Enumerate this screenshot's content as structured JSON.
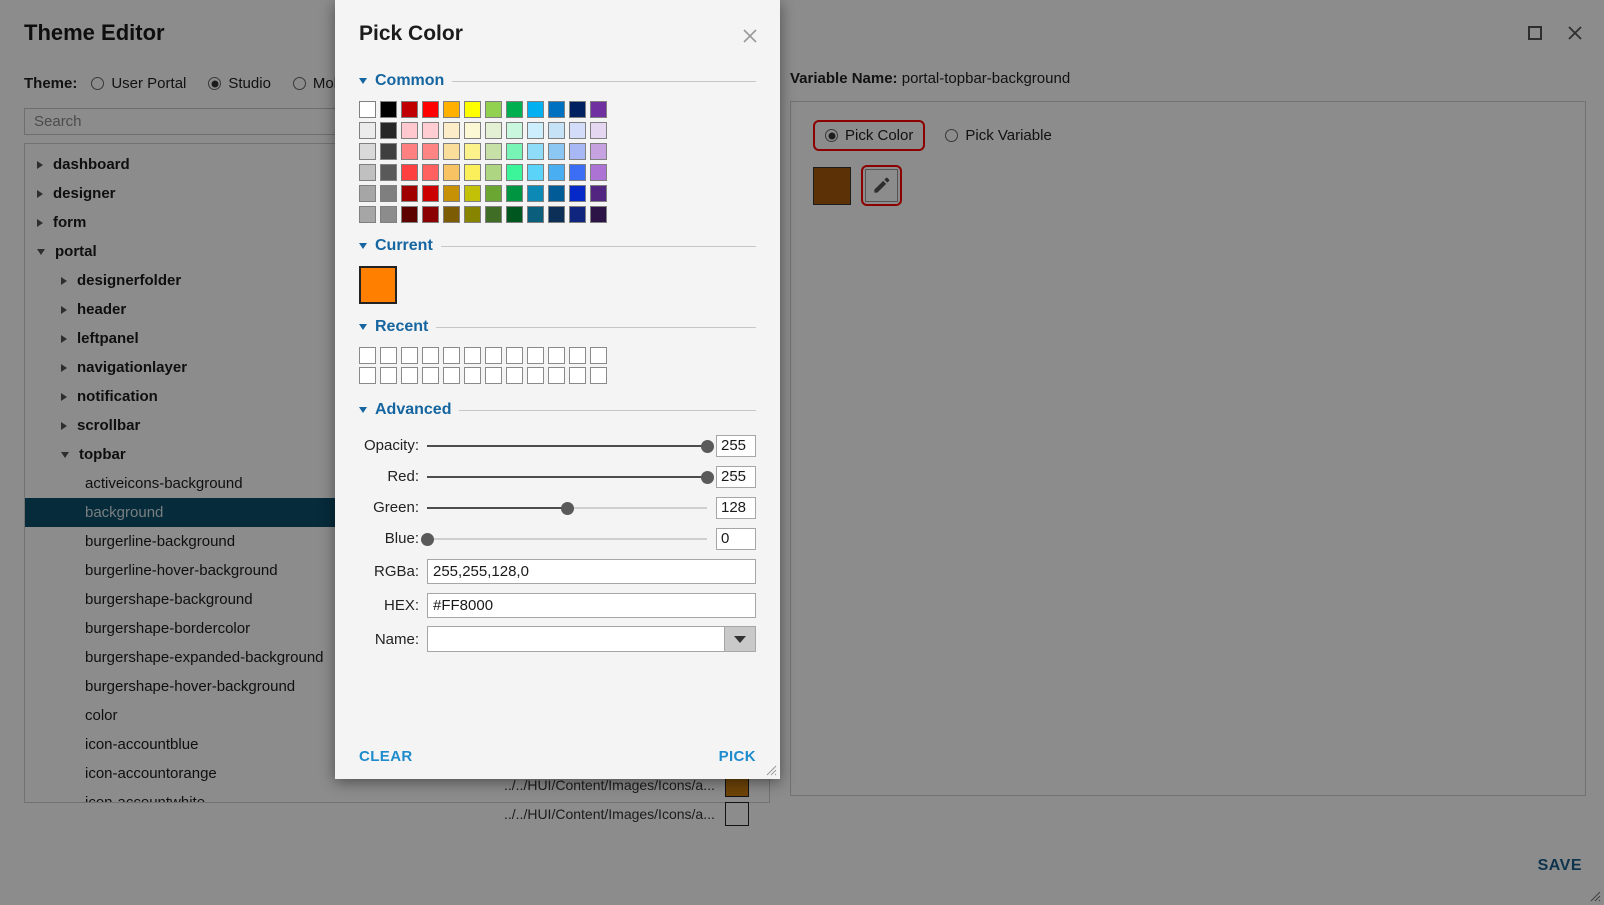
{
  "app": {
    "title": "Theme Editor",
    "window_controls": [
      {
        "name": "maximize-button",
        "glyph": "□"
      },
      {
        "name": "close-button",
        "glyph": "✕"
      }
    ],
    "theme_label": "Theme:",
    "theme_options": [
      {
        "label": "User Portal",
        "selected": false
      },
      {
        "label": "Studio",
        "selected": true
      },
      {
        "label": "Mobile",
        "selected": false
      }
    ],
    "search": {
      "placeholder": "Search",
      "value": ""
    },
    "tree": [
      {
        "label": "dashboard",
        "depth": 0,
        "state": "collapsed",
        "bold": true,
        "selected": false
      },
      {
        "label": "designer",
        "depth": 0,
        "state": "collapsed",
        "bold": true,
        "selected": false
      },
      {
        "label": "form",
        "depth": 0,
        "state": "collapsed",
        "bold": true,
        "selected": false
      },
      {
        "label": "portal",
        "depth": 0,
        "state": "expanded",
        "bold": true,
        "selected": false
      },
      {
        "label": "designerfolder",
        "depth": 1,
        "state": "collapsed",
        "bold": true,
        "selected": false
      },
      {
        "label": "header",
        "depth": 1,
        "state": "collapsed",
        "bold": true,
        "selected": false
      },
      {
        "label": "leftpanel",
        "depth": 1,
        "state": "collapsed",
        "bold": true,
        "selected": false
      },
      {
        "label": "navigationlayer",
        "depth": 1,
        "state": "collapsed",
        "bold": true,
        "selected": false
      },
      {
        "label": "notification",
        "depth": 1,
        "state": "collapsed",
        "bold": true,
        "selected": false
      },
      {
        "label": "scrollbar",
        "depth": 1,
        "state": "collapsed",
        "bold": true,
        "selected": false
      },
      {
        "label": "topbar",
        "depth": 1,
        "state": "expanded",
        "bold": true,
        "selected": false
      },
      {
        "label": "activeicons-background",
        "depth": 2,
        "state": "leaf",
        "bold": false,
        "selected": false
      },
      {
        "label": "background",
        "depth": 2,
        "state": "leaf",
        "bold": false,
        "selected": true
      },
      {
        "label": "burgerline-background",
        "depth": 2,
        "state": "leaf",
        "bold": false,
        "selected": false
      },
      {
        "label": "burgerline-hover-background",
        "depth": 2,
        "state": "leaf",
        "bold": false,
        "selected": false
      },
      {
        "label": "burgershape-background",
        "depth": 2,
        "state": "leaf",
        "bold": false,
        "selected": false
      },
      {
        "label": "burgershape-bordercolor",
        "depth": 2,
        "state": "leaf",
        "bold": false,
        "selected": false
      },
      {
        "label": "burgershape-expanded-background",
        "depth": 2,
        "state": "leaf",
        "bold": false,
        "selected": false
      },
      {
        "label": "burgershape-hover-background",
        "depth": 2,
        "state": "leaf",
        "bold": false,
        "selected": false
      },
      {
        "label": "color",
        "depth": 2,
        "state": "leaf",
        "bold": false,
        "selected": false
      },
      {
        "label": "icon-accountblue",
        "depth": 2,
        "state": "leaf",
        "bold": false,
        "selected": false
      },
      {
        "label": "icon-accountorange",
        "depth": 2,
        "state": "leaf",
        "bold": false,
        "selected": false
      },
      {
        "label": "icon-accountwhite",
        "depth": 2,
        "state": "leaf",
        "bold": false,
        "selected": false
      }
    ],
    "behind_rows": [
      {
        "text": "../../HUI/Content/Images/Icons/a...",
        "swatch": "#c87d10"
      },
      {
        "text": "../../HUI/Content/Images/Icons/a...",
        "swatch": "#ffffff"
      }
    ],
    "right_panel": {
      "variable_name_label": "Variable Name:",
      "variable_name_value": "portal-topbar-background",
      "modes": [
        {
          "label": "Pick Color",
          "selected": true,
          "highlighted": true
        },
        {
          "label": "Pick Variable",
          "selected": false,
          "highlighted": false
        }
      ],
      "current_color_swatch": "#a85a0c",
      "edit_icon": "pencil-icon"
    },
    "save_label": "SAVE"
  },
  "dialog": {
    "title": "Pick Color",
    "close_glyph": "✕",
    "sections": {
      "common": {
        "title": "Common",
        "expanded": true,
        "swatches": [
          [
            "#ffffff",
            "#000000",
            "#c00000",
            "#ff0000",
            "#ffb000",
            "#ffff00",
            "#92d050",
            "#00b050",
            "#00b0f0",
            "#0070c0",
            "#002060",
            "#7030a0"
          ],
          [
            "#ebebeb",
            "#262626",
            "#ffc7ce",
            "#ffcdd2",
            "#fdecc8",
            "#fcf8d5",
            "#e3f0d4",
            "#c9f7dd",
            "#cdeefc",
            "#c6e2f7",
            "#d3ddf9",
            "#e5d6f2"
          ],
          [
            "#d9d9d9",
            "#3f3f3f",
            "#ff8080",
            "#ff8585",
            "#fadd9b",
            "#fbf28c",
            "#c7e0a8",
            "#78f4b6",
            "#8fdcf8",
            "#8cc6f3",
            "#a8b8f4",
            "#c6a3e0"
          ],
          [
            "#c0c0c0",
            "#595959",
            "#ff4040",
            "#ff6060",
            "#f7c363",
            "#fbf05c",
            "#aed581",
            "#3cf59a",
            "#5bd2f7",
            "#49aef2",
            "#3b6ef5",
            "#ac72d4"
          ],
          [
            "#a6a6a6",
            "#7f7f7f",
            "#a00000",
            "#cc0000",
            "#c79105",
            "#c3c107",
            "#6aa631",
            "#009540",
            "#0d89b5",
            "#005b96",
            "#0529c9",
            "#522680"
          ],
          [
            "#a6a6a6",
            "#8c8c8c",
            "#5c0000",
            "#8b0000",
            "#7d5c06",
            "#878400",
            "#3f6d26",
            "#00561f",
            "#0b5f7d",
            "#0b2f57",
            "#10257e",
            "#2d1447"
          ]
        ]
      },
      "current": {
        "title": "Current",
        "expanded": true,
        "color": "#ff8000"
      },
      "recent": {
        "title": "Recent",
        "expanded": true,
        "rows": 2,
        "cols": 12,
        "colors": []
      },
      "advanced": {
        "title": "Advanced",
        "expanded": true,
        "sliders": [
          {
            "label": "Opacity:",
            "value": "255",
            "max": 255,
            "pct": 100
          },
          {
            "label": "Red:",
            "value": "255",
            "max": 255,
            "pct": 100
          },
          {
            "label": "Green:",
            "value": "128",
            "max": 255,
            "pct": 50
          },
          {
            "label": "Blue:",
            "value": "0",
            "max": 255,
            "pct": 0
          }
        ],
        "rgba": {
          "label": "RGBa:",
          "value": "255,255,128,0",
          "placeholder": ""
        },
        "hex": {
          "label": "HEX:",
          "value": "#FF8000",
          "placeholder": ""
        },
        "name": {
          "label": "Name:",
          "value": "",
          "placeholder": ""
        }
      }
    },
    "footer": {
      "clear_label": "CLEAR",
      "pick_label": "PICK"
    }
  },
  "colors": {
    "accent_blue": "#1565a0",
    "link_blue": "#1e8bcd",
    "selection_blue": "#0b4f6c",
    "highlight_red": "#ff0000",
    "save_blue": "#1b5e8a"
  }
}
